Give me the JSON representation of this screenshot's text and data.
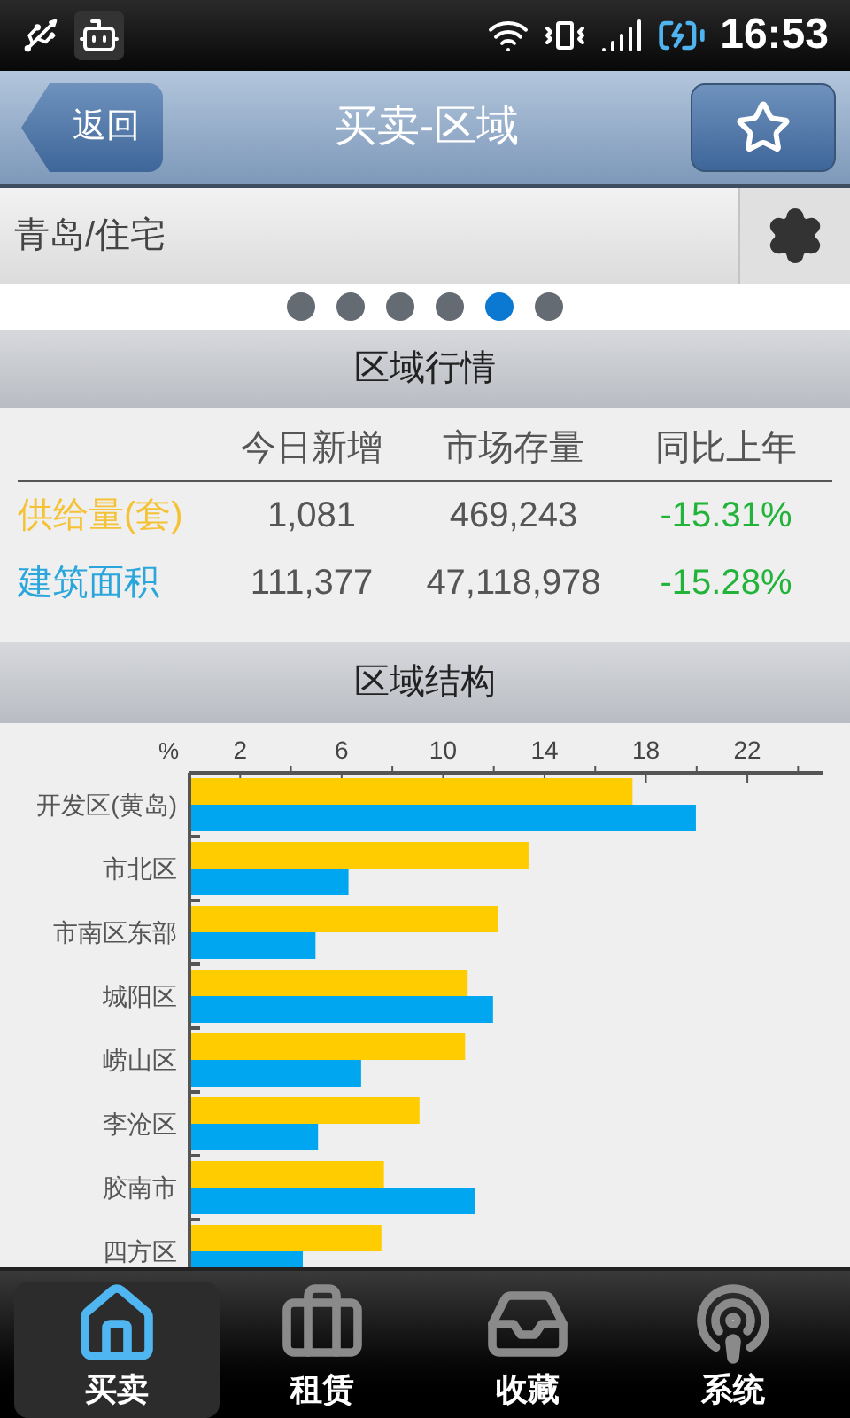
{
  "status_bar": {
    "time": "16:53"
  },
  "header": {
    "back": "返回",
    "title": "买卖-区域"
  },
  "location": {
    "value": "青岛/住宅"
  },
  "pages": [
    {
      "selected": false
    },
    {
      "selected": false
    },
    {
      "selected": false
    },
    {
      "selected": false
    },
    {
      "selected": true
    },
    {
      "selected": false
    }
  ],
  "market": {
    "title": "区域行情",
    "columns": [
      "今日新增",
      "市场存量",
      "同比上年"
    ],
    "rows": [
      {
        "label": "供给量(套)",
        "color": "#f5c236",
        "values": [
          "1,081",
          "469,243",
          "-15.31%"
        ]
      },
      {
        "label": "建筑面积",
        "color": "#2aa6dc",
        "values": [
          "111,377",
          "47,118,978",
          "-15.28%"
        ]
      }
    ]
  },
  "structure": {
    "title": "区域结构",
    "chart_data": {
      "type": "bar",
      "orientation": "horizontal",
      "xlabel": "%",
      "xlim": [
        0,
        25
      ],
      "xticks": [
        2,
        6,
        10,
        14,
        18,
        22
      ],
      "categories": [
        "开发区(黄岛)",
        "市北区",
        "市南区东部",
        "城阳区",
        "崂山区",
        "李沧区",
        "胶南市",
        "四方区"
      ],
      "series": [
        {
          "color": "#ffcc00",
          "values": [
            17.4,
            13.3,
            12.1,
            10.9,
            10.8,
            9.0,
            7.6,
            7.5
          ]
        },
        {
          "color": "#00a6f0",
          "values": [
            19.9,
            6.2,
            4.9,
            11.9,
            6.7,
            5.0,
            11.2,
            4.4
          ]
        }
      ]
    }
  },
  "tabs": [
    {
      "label": "买卖",
      "selected": true
    },
    {
      "label": "租赁",
      "selected": false
    },
    {
      "label": "收藏",
      "selected": false
    },
    {
      "label": "系统",
      "selected": false
    }
  ]
}
